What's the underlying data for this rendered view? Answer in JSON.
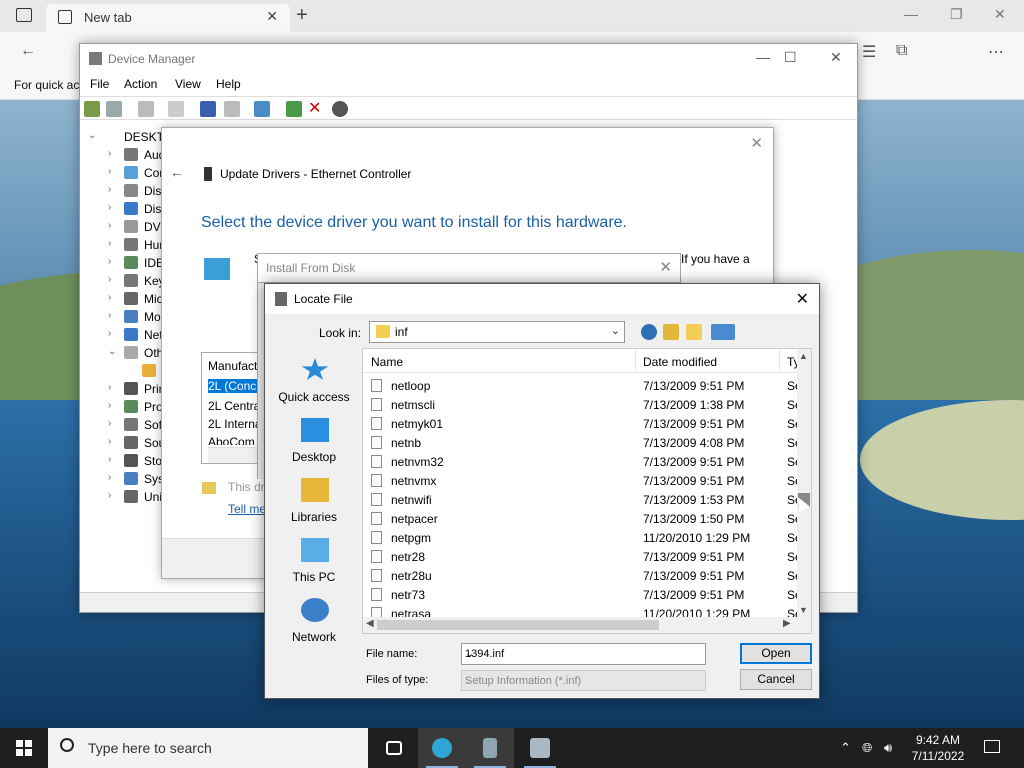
{
  "browser": {
    "tab_label": "New tab",
    "favorites_text": "For quick ac"
  },
  "device_manager": {
    "title": "Device Manager",
    "menu": [
      "File",
      "Action",
      "View",
      "Help"
    ],
    "tree_root": "DESKTO",
    "tree_items": [
      "Aud",
      "Cor",
      "Disk",
      "Disp",
      "DVD",
      "Hun",
      "IDE",
      "Key",
      "Mic",
      "Mo",
      "Net",
      "Oth",
      "Prin",
      "Pro",
      "Soft",
      "Sou",
      "Stor",
      "Syst",
      "Uni"
    ]
  },
  "update_drivers": {
    "title": "Update Drivers - Ethernet Controller",
    "heading": "Select the device driver you want to install for this hardware.",
    "s_letter": "S",
    "side_text": "If you have a",
    "manufacturer_header": "Manufact",
    "manufacturers": [
      "2L (Conc",
      "2L Centra",
      "2L Interna",
      "AboCom"
    ],
    "this_driver": "This dri",
    "tell_me": "Tell me"
  },
  "install_from_disk": {
    "title": "Install From Disk"
  },
  "locate_file": {
    "title": "Locate File",
    "look_in_label": "Look in:",
    "look_in_value": "inf",
    "places": [
      "Quick access",
      "Desktop",
      "Libraries",
      "This PC",
      "Network"
    ],
    "columns": {
      "name": "Name",
      "date": "Date modified",
      "type": "Ty"
    },
    "files": [
      {
        "name": "netloop",
        "date": "7/13/2009 9:51 PM",
        "type": "Se"
      },
      {
        "name": "netmscli",
        "date": "7/13/2009 1:38 PM",
        "type": "Se"
      },
      {
        "name": "netmyk01",
        "date": "7/13/2009 9:51 PM",
        "type": "Se"
      },
      {
        "name": "netnb",
        "date": "7/13/2009 4:08 PM",
        "type": "Se"
      },
      {
        "name": "netnvm32",
        "date": "7/13/2009 9:51 PM",
        "type": "Se"
      },
      {
        "name": "netnvmx",
        "date": "7/13/2009 9:51 PM",
        "type": "Se"
      },
      {
        "name": "netnwifi",
        "date": "7/13/2009 1:53 PM",
        "type": "Se"
      },
      {
        "name": "netpacer",
        "date": "7/13/2009 1:50 PM",
        "type": "Se"
      },
      {
        "name": "netpgm",
        "date": "11/20/2010 1:29 PM",
        "type": "Se"
      },
      {
        "name": "netr28",
        "date": "7/13/2009 9:51 PM",
        "type": "Se"
      },
      {
        "name": "netr28u",
        "date": "7/13/2009 9:51 PM",
        "type": "Se"
      },
      {
        "name": "netr73",
        "date": "7/13/2009 9:51 PM",
        "type": "Se"
      },
      {
        "name": "netrasa",
        "date": "11/20/2010 1:29 PM",
        "type": "Se"
      }
    ],
    "file_name_label": "File name:",
    "file_name_value": "1394.inf",
    "files_of_type_label": "Files of type:",
    "files_of_type_value": "Setup Information (*.inf)",
    "open_label": "Open",
    "cancel_label": "Cancel"
  },
  "taskbar": {
    "search_placeholder": "Type here to search",
    "time": "9:42 AM",
    "date": "7/11/2022"
  }
}
